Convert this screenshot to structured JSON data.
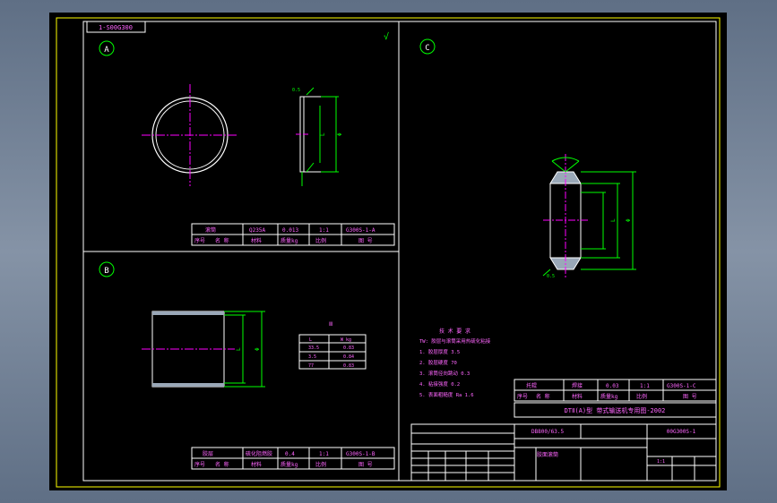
{
  "drawing_number_box": "1-S00G300",
  "views": {
    "a": {
      "marker": "A"
    },
    "b": {
      "marker": "B"
    },
    "c": {
      "marker": "C"
    }
  },
  "title_block_a": {
    "row1": [
      "滚筒",
      "Q235A",
      "0.013",
      "1:1",
      "G300S-1-A"
    ],
    "row2": [
      "序号",
      "名 称",
      "材料",
      "质量kg",
      "比例",
      "图 号"
    ]
  },
  "title_block_b": {
    "row1": [
      "胶层",
      "硫化阻燃胶",
      "0.4",
      "1:1",
      "G300S-1-B"
    ],
    "row2": [
      "序号",
      "名 称",
      "材料",
      "质量kg",
      "比例",
      "图 号"
    ]
  },
  "title_block_c": {
    "row1": [
      "托辊",
      "焊接",
      "0.03",
      "1:1",
      "G300S-1-C"
    ],
    "row2": [
      "序号",
      "名 称",
      "材料",
      "质量kg",
      "比例",
      "图 号"
    ]
  },
  "table_b": {
    "header": [
      "L",
      "W kg"
    ],
    "rows": [
      [
        "33.5",
        "0.83"
      ],
      [
        "3.5",
        "0.84"
      ],
      [
        "77",
        "0.83"
      ]
    ]
  },
  "tech_requirements": {
    "title": "技 术 要 求",
    "items": [
      "TW: 胶层与滚筒采用热硫化粘接",
      "1. 胶层厚度    3.5",
      "2. 胶层硬度    70",
      "3. 滚筒径向跳动  0.3",
      "4. 粘接强度    0.2",
      "5. 表面粗糙度 Ra  1.6"
    ]
  },
  "main_title": {
    "project": "DTⅡ(A)型 带式输送机专用图-2002",
    "spec": "DB800/63.5",
    "code": "00G300S-1",
    "part_name": "胶面滚筒"
  },
  "labels": {
    "dim_d": "Φ",
    "dim_l": "L",
    "dim_small_1": "0.5",
    "table_mark": "Ⅲ",
    "roughness": "√",
    "sheet_mark": "1:1"
  },
  "colors": {
    "paper": "#000000",
    "frame": "#ffff00",
    "geometry": "#ffffff",
    "dimension": "#00ff00",
    "centerline": "#ff00ff",
    "text": "#ff66ff",
    "rubber": "#9aa8b8"
  }
}
